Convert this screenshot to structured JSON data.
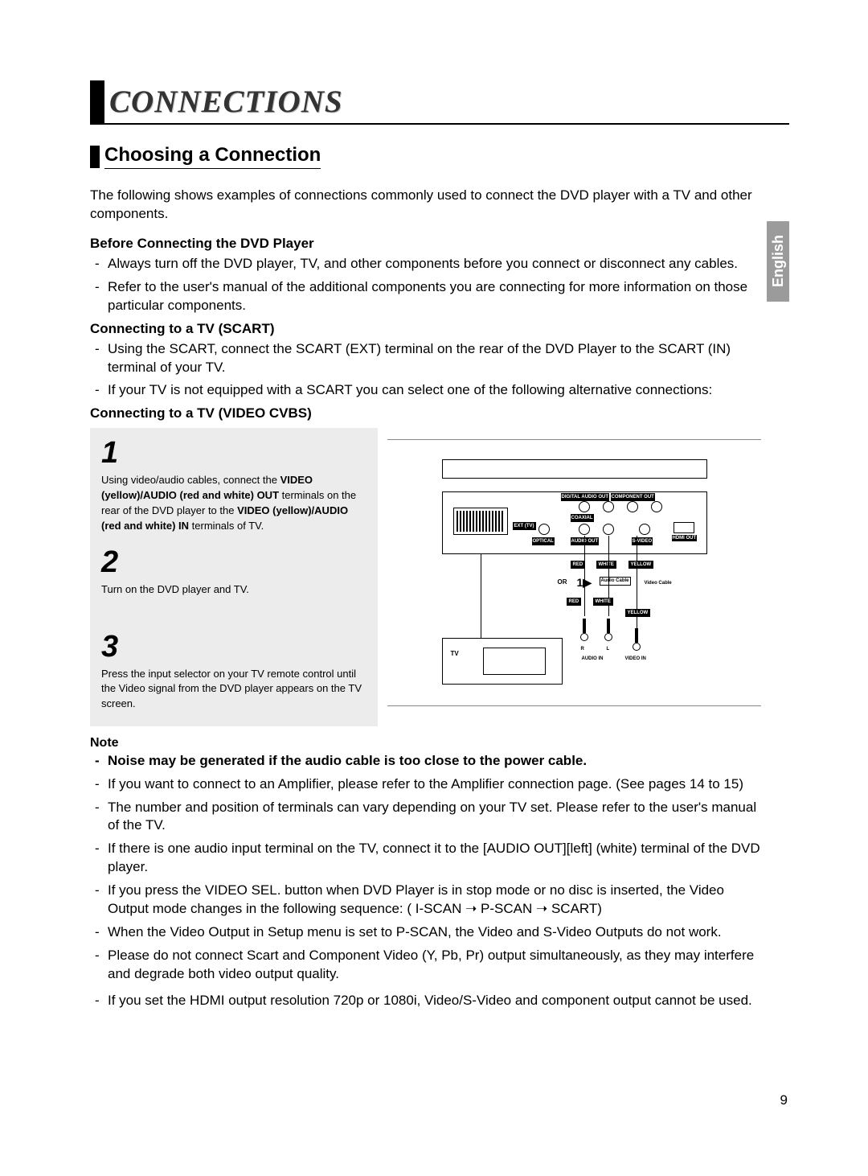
{
  "chapter_title": "CONNECTIONS",
  "section_title": "Choosing a Connection",
  "language_tab": "English",
  "intro": "The following shows examples of connections commonly used to connect the DVD player with a TV and other components.",
  "sub1": {
    "title": "Before Connecting the DVD Player",
    "items": [
      "Always turn off the DVD player, TV, and other components before you connect or disconnect any cables.",
      "Refer to the user's manual of the additional components you are connecting for more information on those particular components."
    ]
  },
  "sub2": {
    "title": "Connecting to a TV (SCART)",
    "items": [
      "Using the SCART, connect the SCART (EXT) terminal on the rear of the DVD Player to the SCART (IN) terminal of your TV.",
      "If your TV is not equipped with a SCART you can select one of the following alternative connections:"
    ]
  },
  "sub3": {
    "title": "Connecting to a TV (VIDEO CVBS)"
  },
  "steps": {
    "s1_num": "1",
    "s1_a": "Using video/audio cables, connect the ",
    "s1_b": "VIDEO (yellow)/AUDIO (red and white) OUT",
    "s1_c": " terminals on the rear of the DVD player to the ",
    "s1_d": "VIDEO (yellow)/AUDIO (red and white) IN",
    "s1_e": "  terminals of TV.",
    "s2_num": "2",
    "s2": "Turn on the DVD player and TV.",
    "s3_num": "3",
    "s3": "Press the input selector on your TV remote control until the Video signal from the DVD player appears on the TV screen."
  },
  "diagram_labels": {
    "digital_audio_out": "DIGITAL AUDIO OUT",
    "coaxial": "COAXIAL",
    "component_out": "COMPONENT OUT",
    "optical": "OPTICAL",
    "audio_out": "AUDIO        OUT",
    "svideo": "S-VIDEO",
    "hdmi_out": "HDMI OUT",
    "ext": "EXT (TV)",
    "red": "RED",
    "white": "WHITE",
    "yellow": "YELLOW",
    "or": "OR",
    "one_arrow": "1▶",
    "audio_cable": "Audio Cable",
    "video_cable": "Video Cable",
    "tv": "TV",
    "audio_in": "AUDIO IN",
    "video_in": "VIDEO IN",
    "r": "R",
    "l": "L"
  },
  "notes": {
    "head": "Note",
    "bold": "Noise may be generated if the audio cable is too close to the power cable.",
    "items": [
      "If you want to connect to an Amplifier, please refer to the Amplifier connection page. (See pages 14 to 15)",
      "The number and position of terminals can vary depending on your TV set. Please refer to the user's manual of the TV.",
      "If there is one audio input terminal on the TV, connect it to the [AUDIO OUT][left] (white) terminal of the DVD player.",
      "If you press the VIDEO SEL. button when DVD Player is in stop mode or no disc is inserted, the Video Output mode changes in the following sequence: ( I-SCAN ➝ P-SCAN ➝ SCART)",
      "When the Video Output in Setup menu is set to P-SCAN, the Video and S-Video Outputs do not work.",
      "Please do not connect Scart and Component Video (Y, Pb, Pr) output simultaneously, as they may interfere and degrade both video output quality.",
      "If you set the HDMI output resolution 720p or 1080i, Video/S-Video and component output cannot be used."
    ]
  },
  "page_number": "9"
}
